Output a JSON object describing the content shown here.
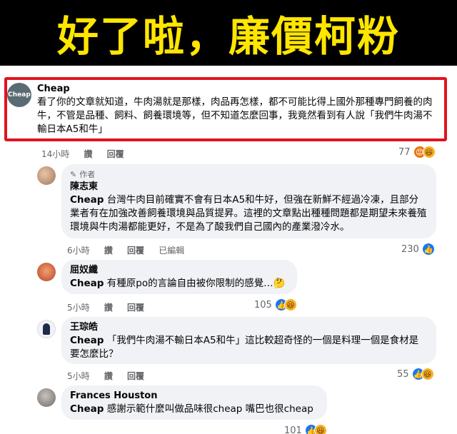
{
  "banner": {
    "title": "好了啦，廉價柯粉",
    "bg": "#000000",
    "color": "#ffe600"
  },
  "main_comment": {
    "avatar_text": "Cheap",
    "author": "Cheap",
    "text": "看了你的文章就知道，牛肉湯就是那樣，肉品再怎樣，都不可能比得上國外那種專門飼養的肉牛，不管是品種、飼料、飼養環境等，但不知道怎麼回事，我竟然看到有人說「我們牛肉湯不輸日本A5和牛」",
    "time": "14小時",
    "like": "讚",
    "reply": "回覆",
    "reaction_count": "77",
    "reactions": [
      "angry-icon",
      "haha-icon"
    ]
  },
  "replies": [
    {
      "author_tag": "作者",
      "author": "陳志東",
      "mention": "Cheap",
      "text": " 台灣牛肉目前確實不會有日本A5和牛好，但強在新鮮不經過冷凍，且部分業者有在加強改善飼養環境與品質提昇。這裡的文章點出種種問題都是期望未來養殖環境與牛肉湯都能更好，不是為了酸我們自己國內的產業潑冷水。",
      "time": "6小時",
      "like": "讚",
      "reply": "回覆",
      "edited": "已編輯",
      "reaction_count": "230",
      "reactions": [
        "like-icon"
      ]
    },
    {
      "author": "屈奴纖",
      "mention": "Cheap",
      "text": " 有種原po的言論自由被你限制的感覺…🤔",
      "time": "5小時",
      "like": "讚",
      "reply": "回覆",
      "reaction_count": "105",
      "reactions": [
        "like-icon",
        "haha-icon"
      ]
    },
    {
      "author": "王琮皓",
      "mention": "Cheap",
      "text": " 「我們牛肉湯不輸日本A5和牛」這比較超奇怪的一個是料理一個是食材是要怎麼比？",
      "time": "5小時",
      "like": "讚",
      "reply": "回覆",
      "reaction_count": "55",
      "reactions": [
        "like-icon",
        "haha-icon"
      ]
    },
    {
      "author": "Frances Houston",
      "mention": "Cheap",
      "text": " 感謝示範什麼叫做品味很cheap 嘴巴也很cheap",
      "reaction_count": "101",
      "reactions": [
        "like-icon",
        "haha-icon"
      ]
    }
  ],
  "colors": {
    "highlight": "#e0141e",
    "bubble": "#f0f2f5",
    "like": "#1877f2",
    "meta": "#65676b"
  }
}
